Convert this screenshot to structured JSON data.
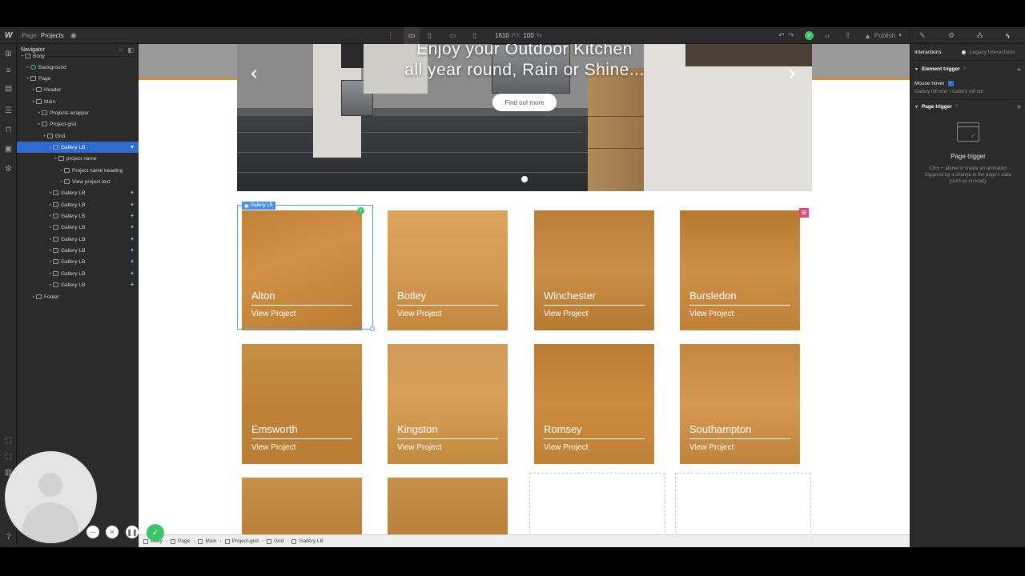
{
  "topbar": {
    "logo": "W",
    "page_label": "Page:",
    "page_name": "Projects",
    "width_value": "1610",
    "width_unit": "PX",
    "zoom_value": "100",
    "zoom_unit": "%",
    "publish_label": "Publish"
  },
  "navigator": {
    "title": "Navigator",
    "items": [
      {
        "label": "Body",
        "depth": 0,
        "icon": "box"
      },
      {
        "label": "Background",
        "depth": 1,
        "icon": "symbol"
      },
      {
        "label": "Page",
        "depth": 1,
        "icon": "box"
      },
      {
        "label": "Header",
        "depth": 2,
        "icon": "box"
      },
      {
        "label": "Main",
        "depth": 2,
        "icon": "box"
      },
      {
        "label": "Projects-wrapper",
        "depth": 3,
        "icon": "box"
      },
      {
        "label": "Project-grid",
        "depth": 3,
        "icon": "box"
      },
      {
        "label": "Grid",
        "depth": 4,
        "icon": "grid"
      },
      {
        "label": "Gallery LB",
        "depth": 5,
        "icon": "lightbox",
        "selected": true
      },
      {
        "label": "project name",
        "depth": 6,
        "icon": "box"
      },
      {
        "label": "Project name heading",
        "depth": 7,
        "icon": "heading"
      },
      {
        "label": "View project text",
        "depth": 7,
        "icon": "text"
      },
      {
        "label": "Gallery LB",
        "depth": 5,
        "icon": "lightbox"
      },
      {
        "label": "Gallery LB",
        "depth": 5,
        "icon": "lightbox"
      },
      {
        "label": "Gallery LB",
        "depth": 5,
        "icon": "lightbox"
      },
      {
        "label": "Gallery LB",
        "depth": 5,
        "icon": "lightbox"
      },
      {
        "label": "Gallery LB",
        "depth": 5,
        "icon": "lightbox"
      },
      {
        "label": "Gallery LB",
        "depth": 5,
        "icon": "lightbox"
      },
      {
        "label": "Gallery LB",
        "depth": 5,
        "icon": "lightbox"
      },
      {
        "label": "Gallery LB",
        "depth": 5,
        "icon": "lightbox"
      },
      {
        "label": "Gallery LB",
        "depth": 5,
        "icon": "lightbox"
      },
      {
        "label": "Footer",
        "depth": 2,
        "icon": "box"
      }
    ]
  },
  "hero": {
    "title_line1": "Enjoy your Outdoor Kitchen",
    "title_line2": "all year round, Rain or Shine...",
    "button_label": "Find out more",
    "prev_arrow": "‹",
    "next_arrow": "›"
  },
  "selection": {
    "label": "Gallery LB"
  },
  "gallery": [
    {
      "title": "Alton",
      "link": "View Project"
    },
    {
      "title": "Botley",
      "link": "View Project"
    },
    {
      "title": "Winchester",
      "link": "View Project"
    },
    {
      "title": "Bursledon",
      "link": "View Project"
    },
    {
      "title": "Emsworth",
      "link": "View Project"
    },
    {
      "title": "Kingston",
      "link": "View Project"
    },
    {
      "title": "Romsey",
      "link": "View Project"
    },
    {
      "title": "Southampton",
      "link": "View Project"
    }
  ],
  "breadcrumbs": [
    "Body",
    "Page",
    "Main",
    "Project-grid",
    "Grid",
    "Gallery LB"
  ],
  "right_panel": {
    "tab_interactions": "Interactions",
    "tab_legacy": "Legacy Interactions",
    "element_trigger": "Element trigger",
    "mouse_hover": "Mouse hover",
    "mouse_hover_desc": "Gallery roll over / Gallery roll out",
    "page_trigger": "Page trigger",
    "page_trigger_heading": "Page trigger",
    "page_trigger_desc": "Click + above to create an animation triggered by a change in the page's state (such as on load)."
  },
  "colors": {
    "overlay": "#d98a2c",
    "accent_line": "#d8892b",
    "selection": "#2d6bd0",
    "panel": "#2b2b2b"
  }
}
